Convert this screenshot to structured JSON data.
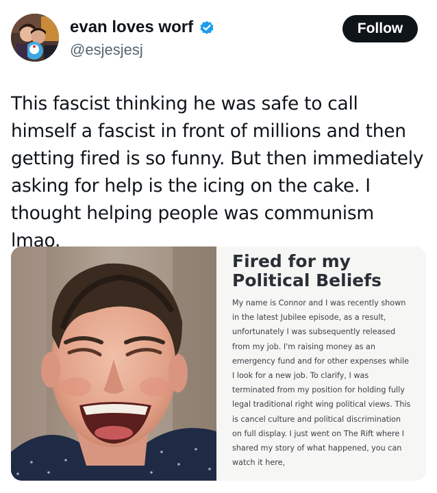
{
  "author": {
    "name": "evan loves worf",
    "handle": "@esjesjesj",
    "verified": true,
    "avatar_icon": "avatar-photo"
  },
  "follow_button": {
    "label": "Follow"
  },
  "tweet": {
    "text": "This fascist thinking he was safe to call himself a fascist in front of millions and then getting fired is so funny. But then immediately asking for help is the icing on the cake. I thought helping people was communism lmao."
  },
  "media": {
    "photo_icon": "laughing-man-photo",
    "card": {
      "title": "Fired for my Political Beliefs",
      "body": "My name is Connor and I was recently shown in the latest Jubilee episode, as a result, unfortunately I was subsequently released from my job. I'm raising money as an emergency fund and for other expenses while I look for a new job. To clarify, I was terminated from my position for holding fully legal traditional right wing political views. This is cancel culture and political discrimination on full display. I just went on The Rift where I shared my story of what happened, you can watch it here,"
    }
  },
  "colors": {
    "text": "#0f1419",
    "secondary_text": "#536471",
    "verified_badge": "#1d9bf0",
    "follow_button_bg": "#0f1419",
    "follow_button_text": "#ffffff",
    "card_bg": "#f6f6f4"
  }
}
